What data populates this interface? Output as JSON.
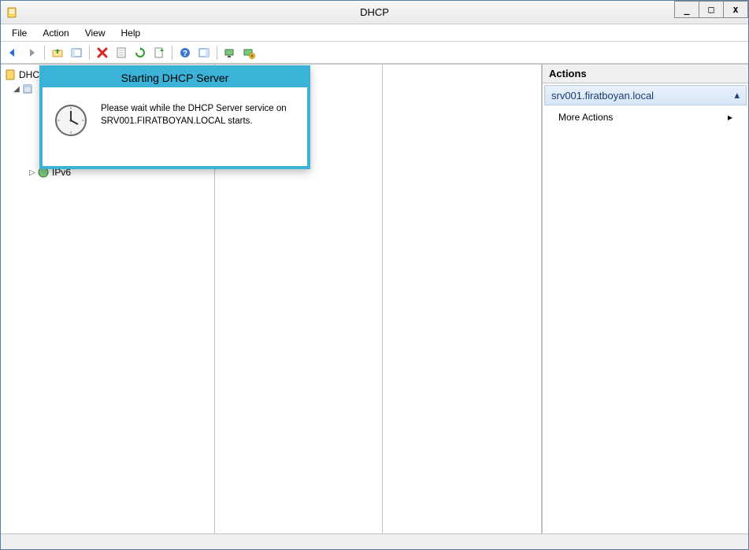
{
  "title": "DHCP",
  "menus": {
    "file": "File",
    "action": "Action",
    "view": "View",
    "help": "Help"
  },
  "tree": {
    "root": "DHCP",
    "ipv6": "IPv6"
  },
  "actions": {
    "header": "Actions",
    "server": "srv001.firatboyan.local",
    "more": "More Actions"
  },
  "dialog": {
    "title": "Starting DHCP Server",
    "line1": "Please wait while the DHCP Server service on",
    "line2": "SRV001.FIRATBOYAN.LOCAL starts."
  },
  "winbtn": {
    "min": "_",
    "max": "□",
    "close": "x"
  }
}
